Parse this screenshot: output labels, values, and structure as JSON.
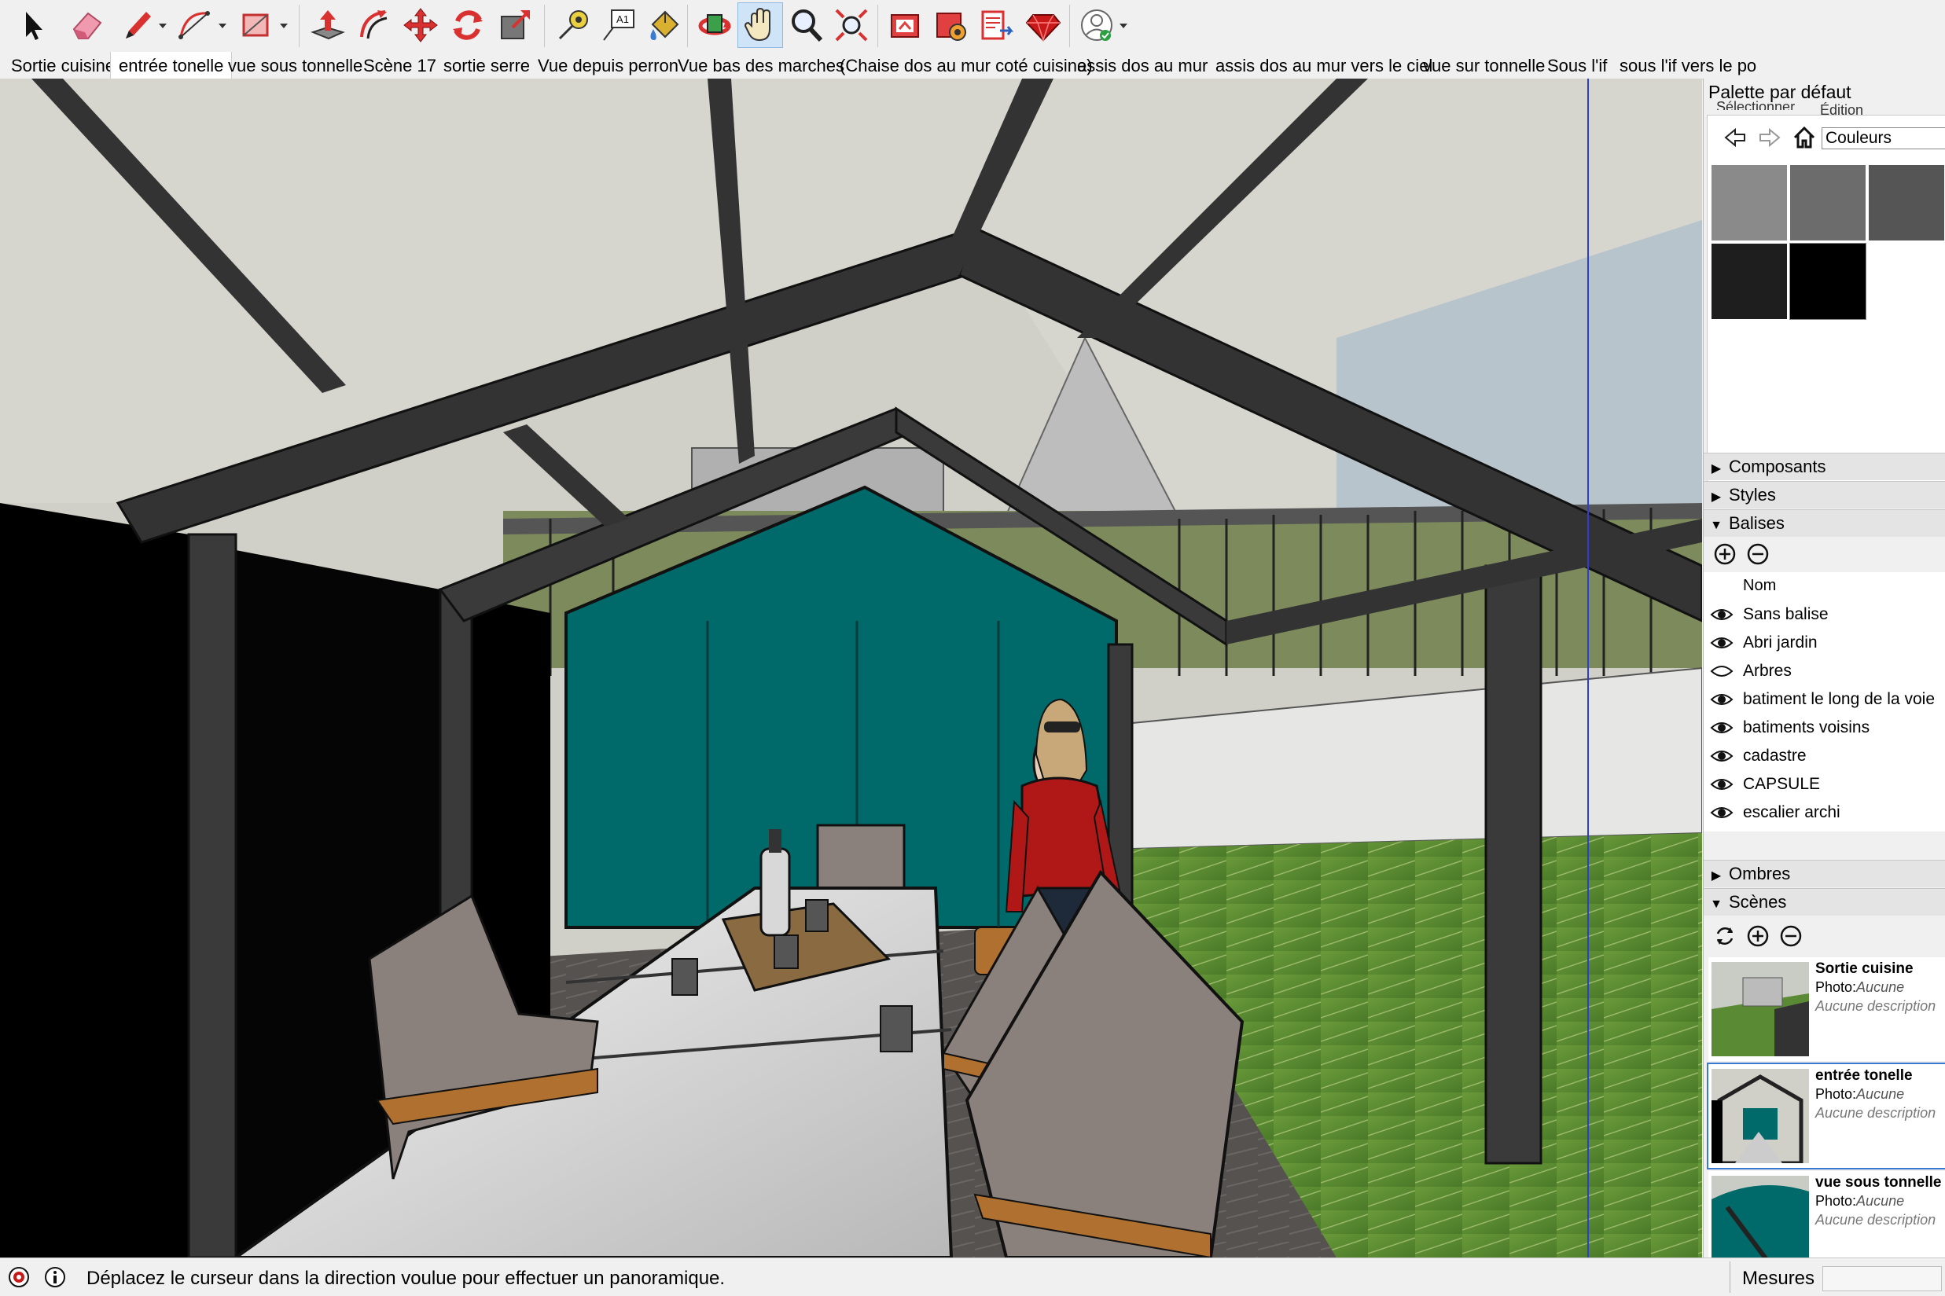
{
  "toolbar": {
    "tools": [
      {
        "name": "select-tool-icon",
        "active": false
      },
      {
        "name": "eraser-tool-icon",
        "active": false
      },
      {
        "name": "line-tool-icon",
        "active": false
      },
      {
        "name": "arc-tool-icon",
        "active": false
      },
      {
        "name": "rectangle-tool-icon",
        "active": false
      },
      {
        "name": "push-pull-tool-icon",
        "active": false
      },
      {
        "name": "offset-tool-icon",
        "active": false
      },
      {
        "name": "move-tool-icon",
        "active": false
      },
      {
        "name": "rotate-tool-icon",
        "active": false
      },
      {
        "name": "scale-tool-icon",
        "active": false
      },
      {
        "name": "tape-measure-tool-icon",
        "active": false
      },
      {
        "name": "text-tool-icon",
        "active": false
      },
      {
        "name": "paint-bucket-tool-icon",
        "active": false
      },
      {
        "name": "orbit-tool-icon",
        "active": false
      },
      {
        "name": "pan-tool-icon",
        "active": true
      },
      {
        "name": "zoom-tool-icon",
        "active": false
      },
      {
        "name": "zoom-extents-tool-icon",
        "active": false
      },
      {
        "name": "warehouse-icon",
        "active": false
      },
      {
        "name": "extension-warehouse-icon",
        "active": false
      },
      {
        "name": "layout-send-icon",
        "active": false
      },
      {
        "name": "ruby-console-icon",
        "active": false
      },
      {
        "name": "account-icon",
        "active": false
      }
    ],
    "text_tool_label": "A1"
  },
  "scene_tabs": [
    "Sortie cuisine",
    "entrée tonelle",
    "vue sous tonnelle",
    "Scène 17",
    "sortie serre",
    "Vue depuis perron",
    "Vue bas des marches",
    "(Chaise dos au mur coté cuisine)",
    "assis dos au mur",
    "assis dos au mur vers le ciel",
    "vue sur tonnelle",
    "Sous l'if",
    "sous l'if vers le po"
  ],
  "active_tab_index": 1,
  "tray": {
    "title": "Palette par défaut",
    "materials": {
      "tab_select": "Sélectionner",
      "tab_edit": "Édition",
      "library": "Couleurs",
      "swatches": [
        "#8a8a8a",
        "#6c6c6c",
        "#555555",
        "#1e1e1e",
        "#000000"
      ]
    },
    "panels": {
      "components": "Composants",
      "styles": "Styles",
      "tags": "Balises",
      "shadows": "Ombres",
      "scenes": "Scènes"
    },
    "tags": {
      "column_name": "Nom",
      "items": [
        {
          "name": "Sans balise",
          "visible": true
        },
        {
          "name": "Abri jardin",
          "visible": true
        },
        {
          "name": "Arbres",
          "visible": false
        },
        {
          "name": "batiment le long de la voie",
          "visible": true
        },
        {
          "name": "batiments voisins",
          "visible": true
        },
        {
          "name": "cadastre",
          "visible": true
        },
        {
          "name": "CAPSULE",
          "visible": true
        },
        {
          "name": "escalier archi",
          "visible": true
        }
      ]
    },
    "scenes": [
      {
        "name": "Sortie cuisine",
        "photo_label": "Photo:",
        "photo_value": "Aucune",
        "description": "Aucune description"
      },
      {
        "name": "entrée tonelle",
        "photo_label": "Photo:",
        "photo_value": "Aucune",
        "description": "Aucune description"
      },
      {
        "name": "vue sous tonnelle",
        "photo_label": "Photo:",
        "photo_value": "Aucune",
        "description": "Aucune description"
      }
    ],
    "active_scene_index": 1
  },
  "status": {
    "message": "Déplacez le curseur dans la direction voulue pour effectuer un panoramique.",
    "measurements_label": "Mesures",
    "measurements_value": ""
  }
}
